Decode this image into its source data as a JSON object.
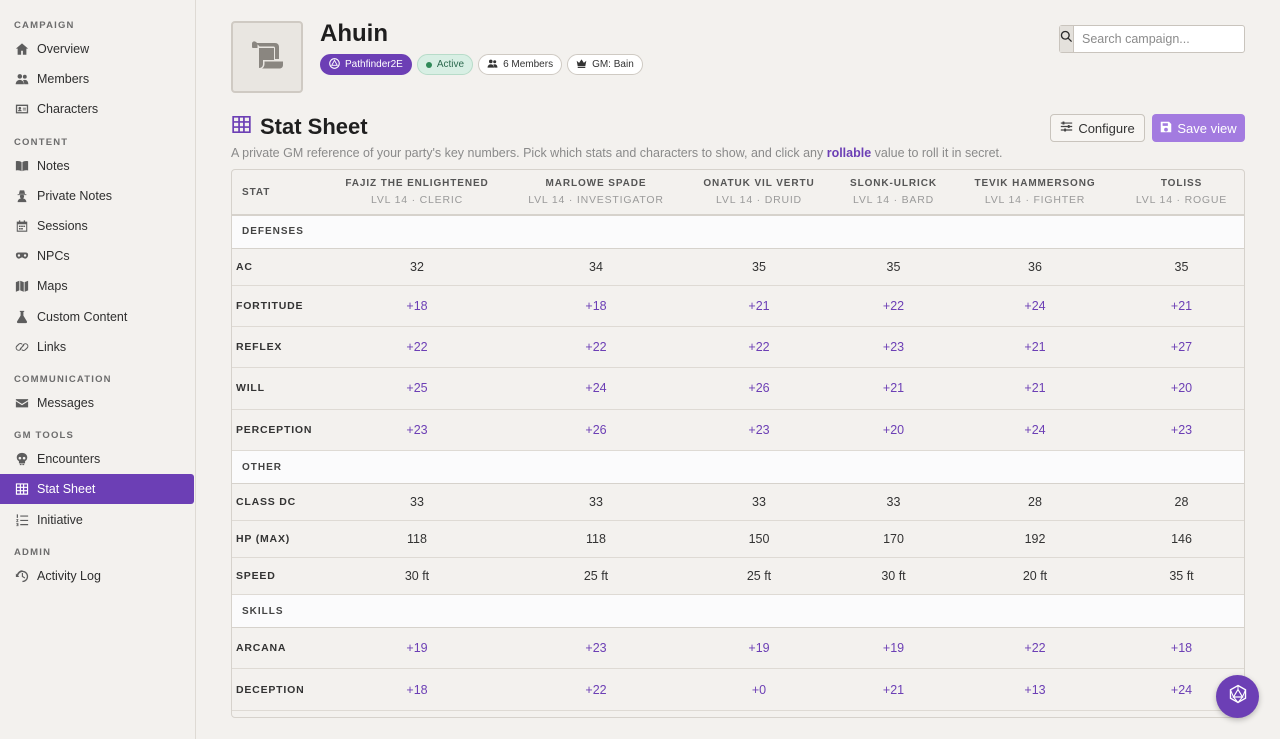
{
  "sidebar": {
    "sections": [
      {
        "label": "CAMPAIGN",
        "items": [
          {
            "label": "Overview",
            "icon": "home-icon"
          },
          {
            "label": "Members",
            "icon": "users-icon"
          },
          {
            "label": "Characters",
            "icon": "id-card-icon"
          }
        ]
      },
      {
        "label": "CONTENT",
        "items": [
          {
            "label": "Notes",
            "icon": "book-icon"
          },
          {
            "label": "Private Notes",
            "icon": "user-secret-icon"
          },
          {
            "label": "Sessions",
            "icon": "calendar-icon"
          },
          {
            "label": "NPCs",
            "icon": "mask-icon"
          },
          {
            "label": "Maps",
            "icon": "map-icon"
          },
          {
            "label": "Custom Content",
            "icon": "flask-icon"
          },
          {
            "label": "Links",
            "icon": "link-icon"
          }
        ]
      },
      {
        "label": "COMMUNICATION",
        "items": [
          {
            "label": "Messages",
            "icon": "envelope-icon"
          }
        ]
      },
      {
        "label": "GM TOOLS",
        "items": [
          {
            "label": "Encounters",
            "icon": "skull-icon"
          },
          {
            "label": "Stat Sheet",
            "icon": "table-icon",
            "active": true
          },
          {
            "label": "Initiative",
            "icon": "list-ol-icon"
          }
        ]
      },
      {
        "label": "ADMIN",
        "items": [
          {
            "label": "Activity Log",
            "icon": "history-icon"
          }
        ]
      }
    ]
  },
  "header": {
    "title": "Ahuin",
    "badges": {
      "system": "Pathfinder2E",
      "status": "Active",
      "members": "6 Members",
      "gm": "GM: Bain"
    },
    "search_placeholder": "Search campaign..."
  },
  "page": {
    "title": "Stat Sheet",
    "description_before": "A private GM reference of your party's key numbers. Pick which stats and characters to show, and click any ",
    "description_link": "rollable",
    "description_after": " value to roll it in secret.",
    "configure_label": "Configure",
    "save_label": "Save view"
  },
  "colors": {
    "accent": "#6c3fb5",
    "save_button": "#a37be0",
    "active_badge_bg": "#d8efe4"
  },
  "table": {
    "stat_header": "STAT",
    "characters": [
      {
        "name": "FAJIZ THE ENLIGHTENED",
        "sub": "LVL 14 · CLERIC"
      },
      {
        "name": "MARLOWE SPADE",
        "sub": "LVL 14 · INVESTIGATOR"
      },
      {
        "name": "ONATUK VIL VERTU",
        "sub": "LVL 14 · DRUID"
      },
      {
        "name": "SLONK-ULRICK",
        "sub": "LVL 14 · BARD"
      },
      {
        "name": "TEVIK HAMMERSONG",
        "sub": "LVL 14 · FIGHTER"
      },
      {
        "name": "TOLISS",
        "sub": "LVL 14 · ROGUE"
      }
    ],
    "groups": [
      {
        "label": "DEFENSES",
        "rows": [
          {
            "label": "AC",
            "rollable": false,
            "values": [
              "32",
              "34",
              "35",
              "35",
              "36",
              "35"
            ]
          },
          {
            "label": "FORTITUDE",
            "rollable": true,
            "values": [
              "+18",
              "+18",
              "+21",
              "+22",
              "+24",
              "+21"
            ]
          },
          {
            "label": "REFLEX",
            "rollable": true,
            "values": [
              "+22",
              "+22",
              "+22",
              "+23",
              "+21",
              "+27"
            ]
          },
          {
            "label": "WILL",
            "rollable": true,
            "values": [
              "+25",
              "+24",
              "+26",
              "+21",
              "+21",
              "+20"
            ]
          },
          {
            "label": "PERCEPTION",
            "rollable": true,
            "values": [
              "+23",
              "+26",
              "+23",
              "+20",
              "+24",
              "+23"
            ]
          }
        ]
      },
      {
        "label": "OTHER",
        "rows": [
          {
            "label": "CLASS DC",
            "rollable": false,
            "values": [
              "33",
              "33",
              "33",
              "33",
              "28",
              "28"
            ]
          },
          {
            "label": "HP (MAX)",
            "rollable": false,
            "values": [
              "118",
              "118",
              "150",
              "170",
              "192",
              "146"
            ]
          },
          {
            "label": "SPEED",
            "rollable": false,
            "values": [
              "30 ft",
              "25 ft",
              "25 ft",
              "30 ft",
              "20 ft",
              "35 ft"
            ]
          }
        ]
      },
      {
        "label": "SKILLS",
        "rows": [
          {
            "label": "ARCANA",
            "rollable": true,
            "values": [
              "+19",
              "+23",
              "+19",
              "+19",
              "+22",
              "+18"
            ]
          },
          {
            "label": "DECEPTION",
            "rollable": true,
            "values": [
              "+18",
              "+22",
              "+0",
              "+21",
              "+13",
              "+24"
            ]
          }
        ]
      }
    ]
  },
  "fab": {
    "icon": "d20-dice-icon"
  }
}
